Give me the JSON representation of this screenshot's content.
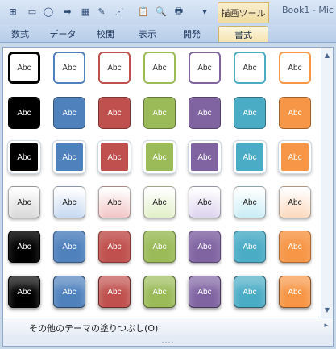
{
  "quick_access": {
    "icons": [
      "selection-pane-icon",
      "rectangle-icon",
      "oval-icon",
      "arrow-icon",
      "table-icon",
      "pen-icon",
      "connector-icon",
      "paste-icon",
      "print-preview-icon",
      "print-icon",
      "dropdown-icon"
    ],
    "glyphs": [
      "⊞",
      "▭",
      "◯",
      "➡",
      "▦",
      "✎",
      "⋰",
      "📋",
      "🔍",
      "🖶",
      "▾"
    ]
  },
  "contextual_label": "描画ツール",
  "window_title": "Book1 - Mic",
  "tabs": [
    {
      "label": "数式",
      "active": false
    },
    {
      "label": "データ",
      "active": false
    },
    {
      "label": "校閲",
      "active": false
    },
    {
      "label": "表示",
      "active": false
    },
    {
      "label": "開発",
      "active": false
    },
    {
      "label": "書式",
      "active": true
    }
  ],
  "swatch_label": "Abc",
  "theme_colors": [
    "#000000",
    "#4f81bd",
    "#c0504d",
    "#9bbb59",
    "#8064a2",
    "#4bacc6",
    "#f79646"
  ],
  "row_light_colors": {
    "row4": [
      "#d9d9d9",
      "#c6d9f1",
      "#f2c4c4",
      "#e2efc7",
      "#ddd3ee",
      "#c9edf5",
      "#fcd9bc"
    ]
  },
  "gallery_rows": 6,
  "more_fills_label": "その他のテーマの塗りつぶし(O)",
  "more_fills_arrow": "▸",
  "gripper": "....",
  "scroll_up": "▲",
  "scroll_down": "▼"
}
